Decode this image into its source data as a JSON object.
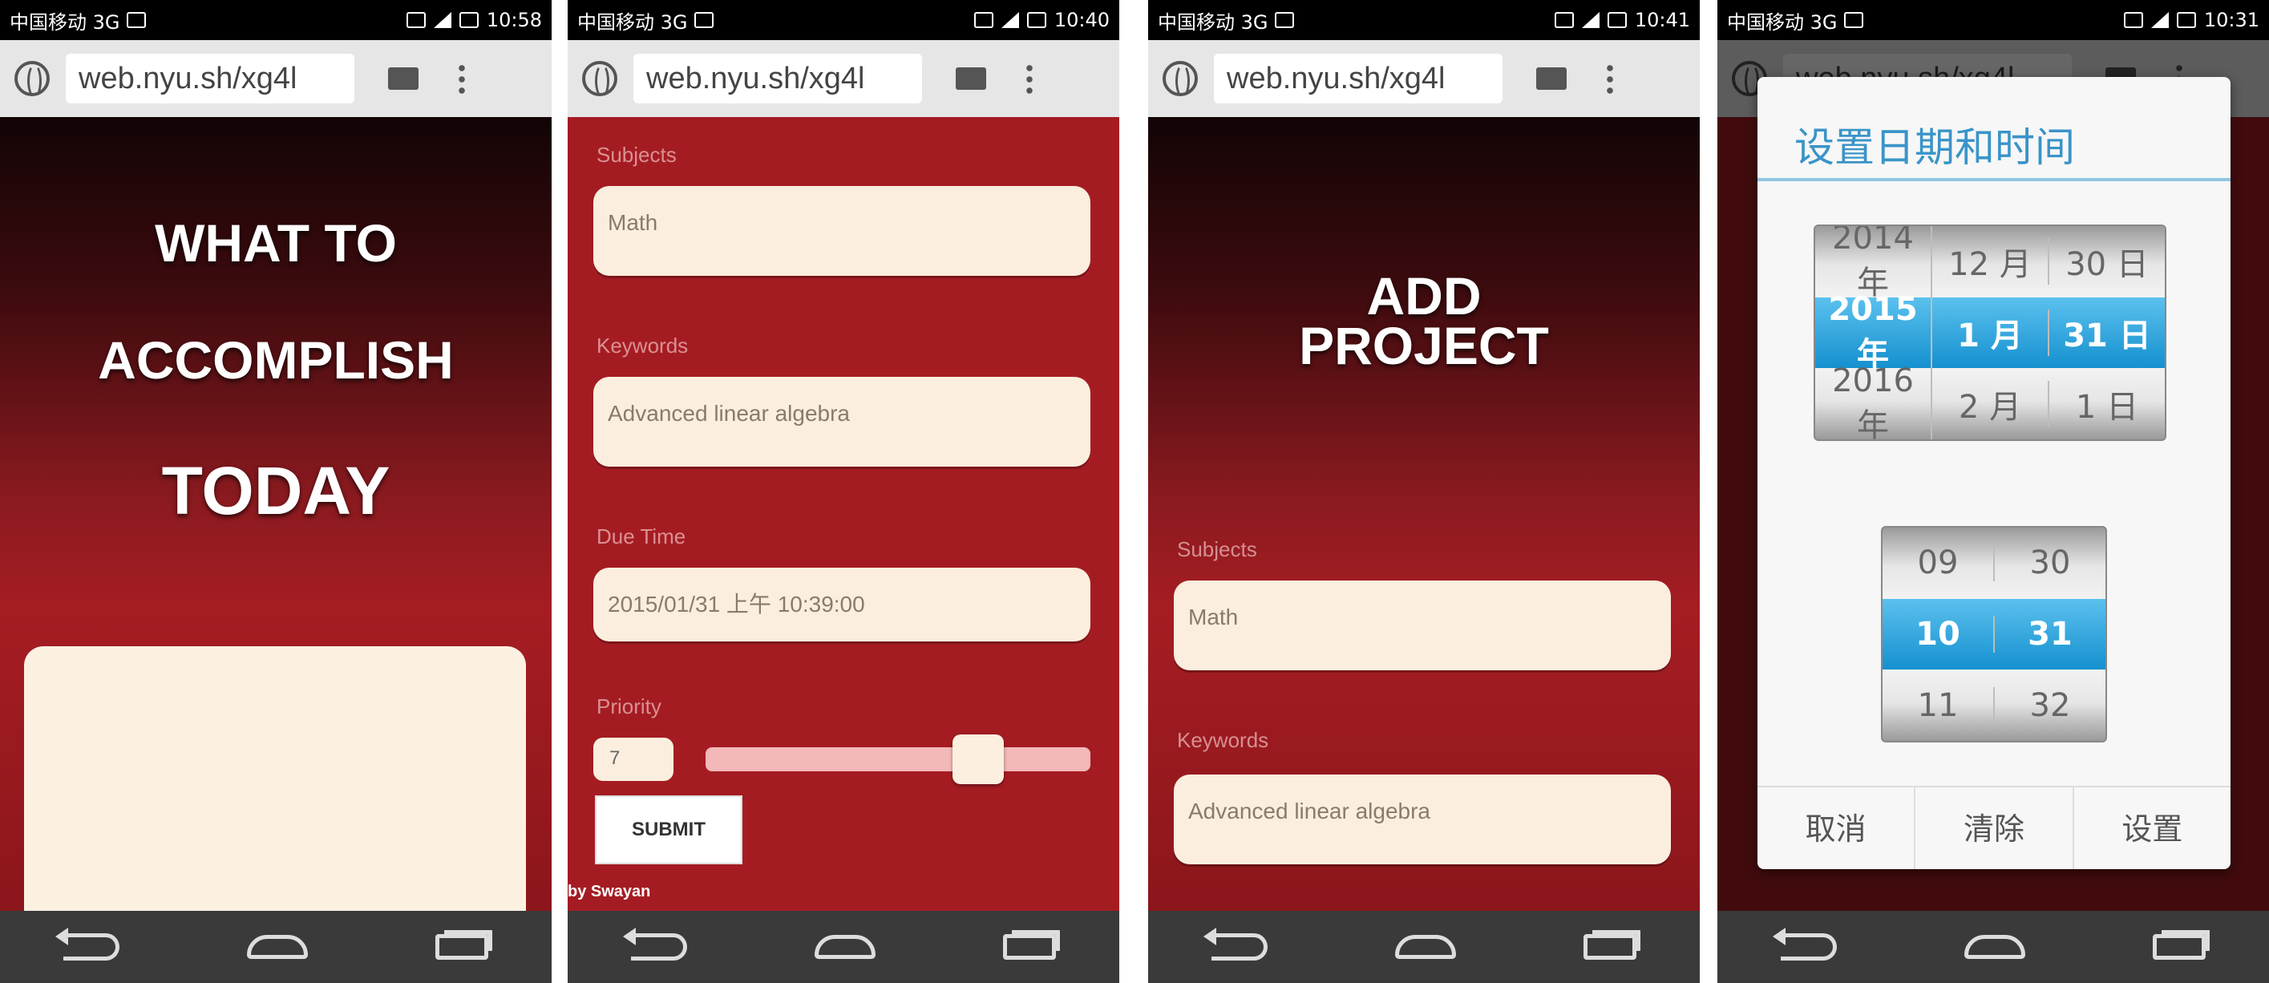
{
  "statusbars": [
    {
      "carrier": "中国移动 3G",
      "time": "10:58"
    },
    {
      "carrier": "中国移动 3G",
      "time": "10:40"
    },
    {
      "carrier": "中国移动 3G",
      "time": "10:41"
    },
    {
      "carrier": "中国移动 3G",
      "time": "10:31"
    }
  ],
  "browser": {
    "url": "web.nyu.sh/xg4l"
  },
  "screen1": {
    "title_line1": "WHAT TO",
    "title_line2": "ACCOMPLISH",
    "title_line3": "TODAY"
  },
  "screen2": {
    "subject_label": "Subjects",
    "subject_value": "Math",
    "keywords_label": "Keywords",
    "keywords_value": "Advanced linear algebra",
    "due_label": "Due Time",
    "due_value": "2015/01/31 上午 10:39:00",
    "priority_label": "Priority",
    "priority_value": "7",
    "priority_level": 0.74,
    "submit_label": "SUBMIT",
    "credit": "by Swayan"
  },
  "screen3": {
    "title_line1": "ADD",
    "title_line2": "PROJECT",
    "subject_label": "Subjects",
    "subject_value": "Math",
    "keywords_label": "Keywords",
    "keywords_value": "Advanced linear algebra"
  },
  "dialog": {
    "title": "设置日期和时间",
    "date_wheel": [
      {
        "year": "2014 年",
        "month": "12 月",
        "day": "30 日"
      },
      {
        "year": "2015 年",
        "month": "1 月",
        "day": "31 日"
      },
      {
        "year": "2016 年",
        "month": "2 月",
        "day": "1 日"
      }
    ],
    "time_wheel": [
      {
        "hour": "09",
        "minute": "30"
      },
      {
        "hour": "10",
        "minute": "31"
      },
      {
        "hour": "11",
        "minute": "32"
      }
    ],
    "cancel": "取消",
    "clear": "清除",
    "set": "设置"
  },
  "colors": {
    "accent_red": "#a41c22",
    "cream": "#fbeede",
    "picker_blue": "#1590cf"
  }
}
